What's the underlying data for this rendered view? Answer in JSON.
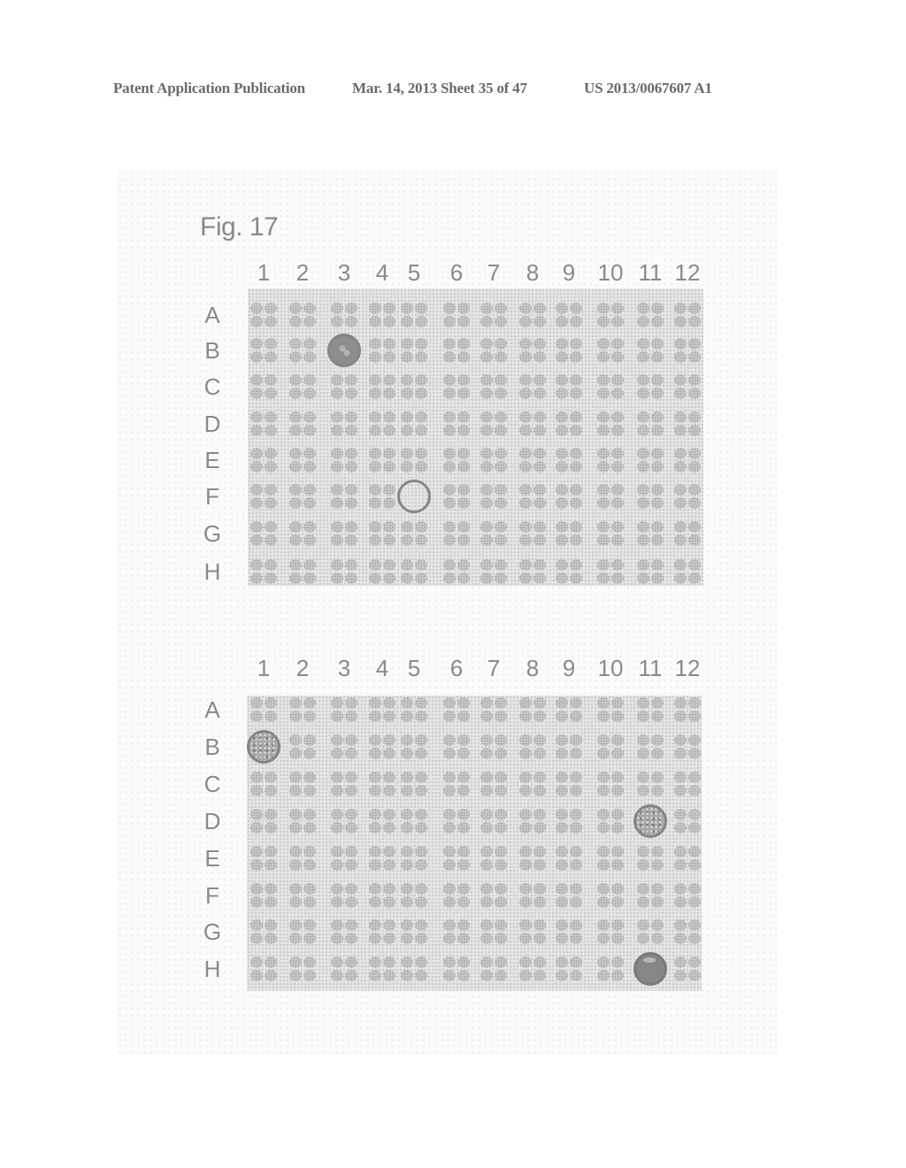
{
  "header": {
    "publication_type": "Patent Application Publication",
    "date_sheet": "Mar. 14, 2013  Sheet 35 of 47",
    "patent_number": "US 2013/0067607 A1"
  },
  "figure": {
    "title": "Fig. 17",
    "plates": [
      {
        "columns": [
          "1",
          "2",
          "3",
          "4",
          "5",
          "6",
          "7",
          "8",
          "9",
          "10",
          "11",
          "12"
        ],
        "rows": [
          "A",
          "B",
          "C",
          "D",
          "E",
          "F",
          "G",
          "H"
        ],
        "highlighted_wells": [
          {
            "well": "B3",
            "style": "filled"
          },
          {
            "well": "F5",
            "style": "ring"
          }
        ]
      },
      {
        "columns": [
          "1",
          "2",
          "3",
          "4",
          "5",
          "6",
          "7",
          "8",
          "9",
          "10",
          "11",
          "12"
        ],
        "rows": [
          "A",
          "B",
          "C",
          "D",
          "E",
          "F",
          "G",
          "H"
        ],
        "highlighted_wells": [
          {
            "well": "B1",
            "style": "speckled"
          },
          {
            "well": "D11",
            "style": "speckled"
          },
          {
            "well": "H11",
            "style": "solid"
          }
        ]
      }
    ]
  }
}
